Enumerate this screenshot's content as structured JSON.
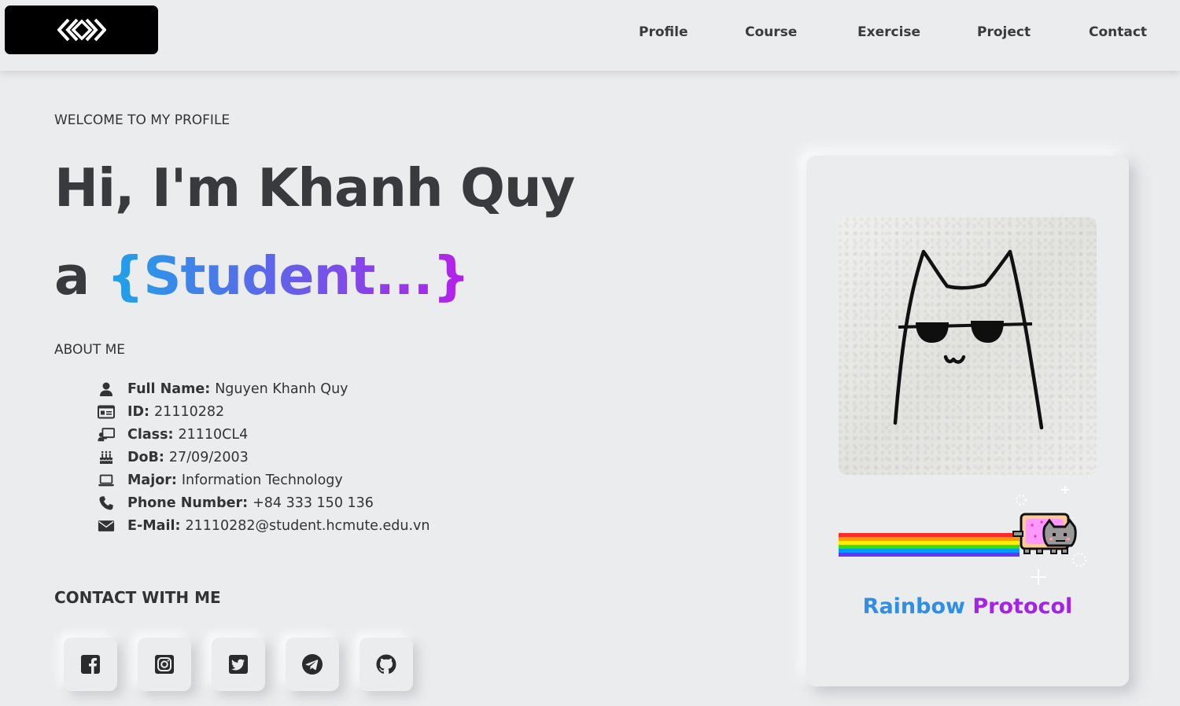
{
  "header": {
    "logo_icon": "code-brackets-icon",
    "nav": [
      {
        "label": "Profile"
      },
      {
        "label": "Course"
      },
      {
        "label": "Exercise"
      },
      {
        "label": "Project"
      },
      {
        "label": "Contact"
      }
    ]
  },
  "hero": {
    "welcome": "WELCOME TO MY PROFILE",
    "greeting": "Hi, I'm Khanh Quy",
    "role_prefix": "a",
    "role_text": "{Student...}",
    "about_title": "ABOUT ME"
  },
  "about": [
    {
      "icon": "user-icon",
      "label": "Full Name:",
      "value": "Nguyen Khanh Quy"
    },
    {
      "icon": "id-card-icon",
      "label": "ID:",
      "value": "21110282"
    },
    {
      "icon": "chalkboard-teacher-icon",
      "label": "Class:",
      "value": "21110CL4"
    },
    {
      "icon": "birthday-cake-icon",
      "label": "DoB:",
      "value": "27/09/2003"
    },
    {
      "icon": "laptop-icon",
      "label": "Major:",
      "value": "Information Technology"
    },
    {
      "icon": "phone-icon",
      "label": "Phone Number:",
      "value": "+84 333 150 136"
    },
    {
      "icon": "envelope-icon",
      "label": "E-Mail:",
      "value": "21110282@student.hcmute.edu.vn"
    }
  ],
  "contact": {
    "title": "CONTACT WITH ME",
    "links": [
      {
        "icon": "facebook-icon"
      },
      {
        "icon": "instagram-icon"
      },
      {
        "icon": "twitter-icon"
      },
      {
        "icon": "telegram-icon"
      },
      {
        "icon": "github-icon"
      }
    ]
  },
  "card": {
    "image": "cat-with-sunglasses-drawing",
    "animation": "nyan-cat-rainbow",
    "title_part1": "Rainbow",
    "title_part2": "Protocol"
  },
  "colors": {
    "background": "#ebecee",
    "text_dark": "#393a3d",
    "gradient_start": "#1fa3e8",
    "gradient_mid": "#5d66e8",
    "gradient_end": "#b61fe8"
  }
}
